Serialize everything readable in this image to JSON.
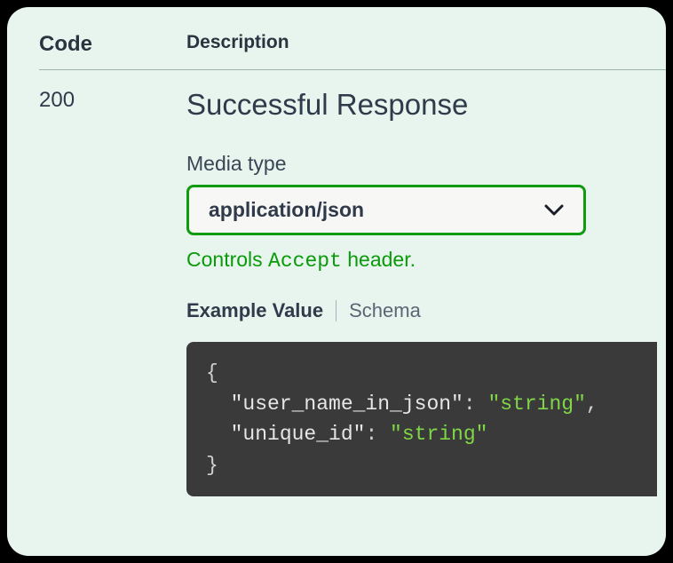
{
  "headers": {
    "code": "Code",
    "description": "Description"
  },
  "response": {
    "code": "200",
    "title": "Successful Response",
    "media_label": "Media type",
    "media_value": "application/json",
    "hint_prefix": "Controls ",
    "hint_code": "Accept",
    "hint_suffix": " header.",
    "tab_example": "Example Value",
    "tab_schema": "Schema",
    "example": {
      "open": "{",
      "line1_key": "\"user_name_in_json\"",
      "line1_val": "\"string\"",
      "line2_key": "\"unique_id\"",
      "line2_val": "\"string\"",
      "close": "}"
    }
  }
}
